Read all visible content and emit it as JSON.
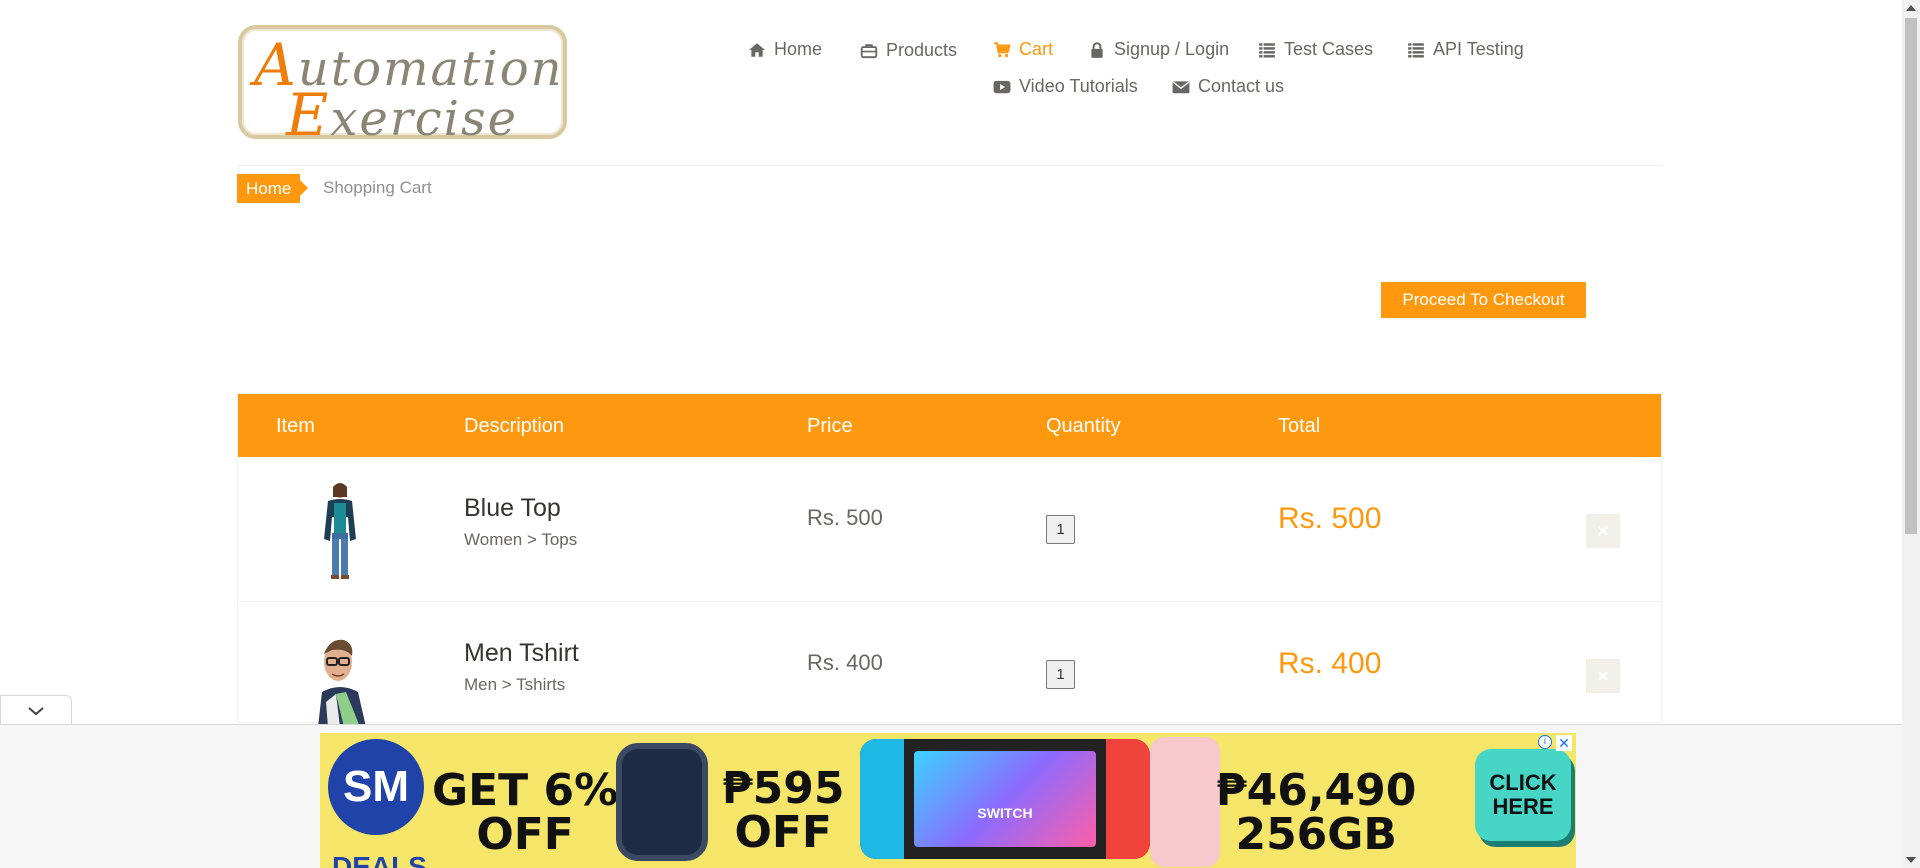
{
  "logo": {
    "line1_cap": "A",
    "line1_rest": "utomation",
    "line2_cap": "E",
    "line2_rest": "xercise"
  },
  "nav": {
    "items": [
      {
        "label": "Home",
        "icon": "home-icon"
      },
      {
        "label": "Products",
        "icon": "briefcase-icon"
      },
      {
        "label": "Cart",
        "icon": "shopping-cart-icon",
        "active": true
      },
      {
        "label": "Signup / Login",
        "icon": "lock-icon"
      },
      {
        "label": "Test Cases",
        "icon": "list-icon"
      },
      {
        "label": "API Testing",
        "icon": "list-icon"
      },
      {
        "label": "Video Tutorials",
        "icon": "youtube-play-icon"
      },
      {
        "label": "Contact us",
        "icon": "envelope-icon"
      }
    ],
    "active_color": "#fe980f"
  },
  "breadcrumb": {
    "home": "Home",
    "current": "Shopping Cart"
  },
  "checkout_button": "Proceed To Checkout",
  "cart": {
    "headers": {
      "item": "Item",
      "description": "Description",
      "price": "Price",
      "quantity": "Quantity",
      "total": "Total"
    },
    "rows": [
      {
        "name": "Blue Top",
        "category": "Women > Tops",
        "price": "Rs. 500",
        "quantity": "1",
        "total": "Rs. 500",
        "image": "woman-model-image"
      },
      {
        "name": "Men Tshirt",
        "category": "Men > Tshirts",
        "price": "Rs. 400",
        "quantity": "1",
        "total": "Rs. 400",
        "image": "man-model-image"
      }
    ]
  },
  "ad": {
    "brand": "SM",
    "deals": "DEALS",
    "offer1_line1": "GET 6%",
    "offer1_line2": "OFF",
    "offer2_line1": "₱595",
    "offer2_line2": "OFF",
    "switch_label": "SWITCH",
    "offer3_line1": "₱46,490",
    "offer3_line2": "256GB",
    "cta_line1": "CLICK",
    "cta_line2": "HERE",
    "info": "i",
    "close": "✕"
  },
  "colors": {
    "brand_orange": "#fe980f",
    "text": "#696763"
  }
}
